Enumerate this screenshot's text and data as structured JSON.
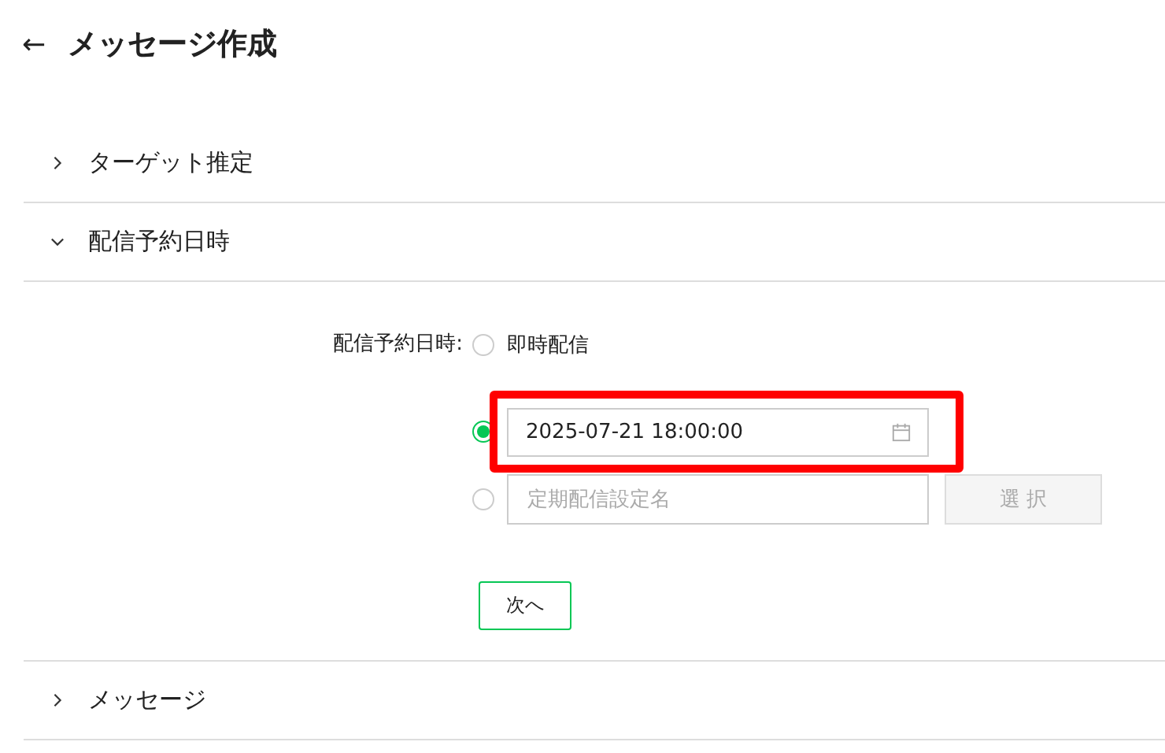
{
  "header": {
    "back": "←",
    "title": "メッセージ作成"
  },
  "sections": [
    {
      "title": "ターゲット推定",
      "expanded": false
    },
    {
      "title": "配信予約日時",
      "expanded": true,
      "form": {
        "label": "配信予約日時:",
        "options": [
          {
            "kind": "text",
            "selected": false,
            "label": "即時配信"
          },
          {
            "kind": "datetime",
            "selected": true,
            "value": "2025-07-21 18:00:00",
            "highlighted": true
          },
          {
            "kind": "preset",
            "selected": false,
            "placeholder": "定期配信設定名",
            "button": {
              "label": "選 択",
              "disabled": true
            }
          }
        ],
        "next": "次へ"
      }
    },
    {
      "title": "メッセージ",
      "expanded": false
    }
  ]
}
